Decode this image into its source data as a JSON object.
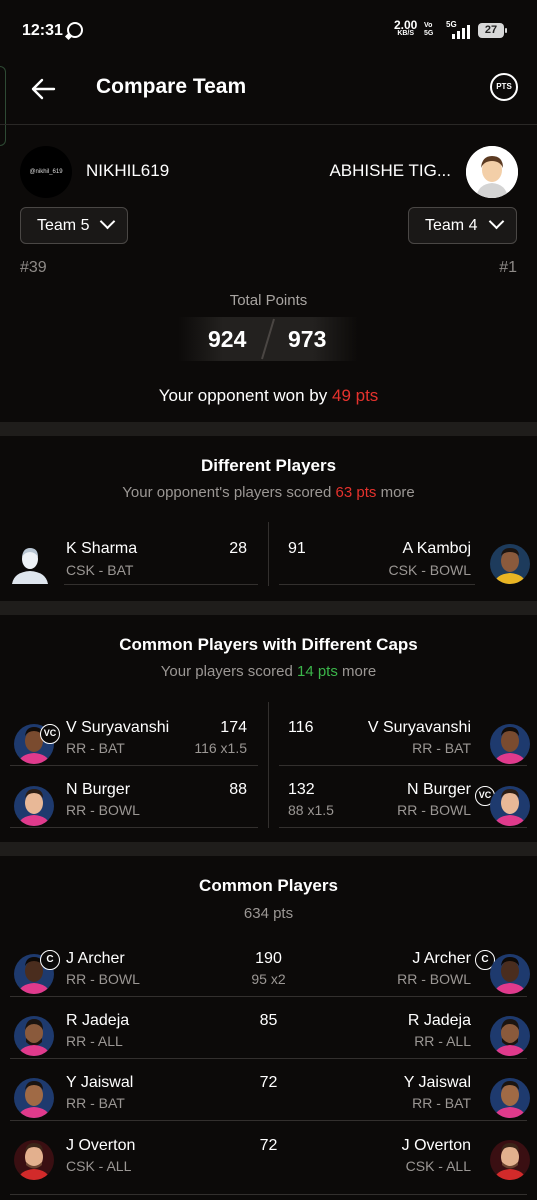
{
  "status_bar": {
    "time": "12:31",
    "whatsapp_icon": "whatsapp-icon",
    "net_speed": "2.00",
    "net_unit": "KB/S",
    "volte": "Vo",
    "volte2": "5G",
    "network": "5G",
    "battery": "27"
  },
  "header": {
    "title": "Compare Team",
    "back_icon": "arrow-left-icon",
    "pts_label": "PTS"
  },
  "left_team": {
    "avatar_text": "@nikhil_619",
    "username": "NIKHIL619",
    "team": "Team 5",
    "rank": "#39",
    "points": "924"
  },
  "right_team": {
    "username": "ABHISHE TIG...",
    "team": "Team 4",
    "rank": "#1",
    "points": "973"
  },
  "total_points_label": "Total Points",
  "result": {
    "prefix": "Your opponent won by ",
    "value": "49 pts"
  },
  "different_players": {
    "title": "Different Players",
    "sub_prefix": "Your opponent's players scored ",
    "sub_value": "63 pts",
    "sub_suffix": " more",
    "left": [
      {
        "name": "K Sharma",
        "role": "CSK - BAT",
        "pts": "28"
      }
    ],
    "right": [
      {
        "name": "A Kamboj",
        "role": "CSK - BOWL",
        "pts": "91"
      }
    ]
  },
  "common_diff_caps": {
    "title": "Common Players with Different Caps",
    "sub_prefix": "Your players scored ",
    "sub_value": "14 pts",
    "sub_suffix": " more",
    "left": [
      {
        "name": "V Suryavanshi",
        "role": "RR - BAT",
        "pts": "174",
        "mult": "116 x1.5",
        "cap": "VC"
      },
      {
        "name": "N Burger",
        "role": "RR - BOWL",
        "pts": "88",
        "mult": "",
        "cap": ""
      }
    ],
    "right": [
      {
        "name": "V Suryavanshi",
        "role": "RR - BAT",
        "pts": "116",
        "mult": "",
        "cap": ""
      },
      {
        "name": "N Burger",
        "role": "RR - BOWL",
        "pts": "132",
        "mult": "88 x1.5",
        "cap": "VC"
      }
    ]
  },
  "common_players": {
    "title": "Common Players",
    "sub": "634 pts",
    "rows": [
      {
        "name": "J Archer",
        "role": "RR - BOWL",
        "pts": "190",
        "mult": "95 x2",
        "cap": "C"
      },
      {
        "name": "R Jadeja",
        "role": "RR - ALL",
        "pts": "85",
        "mult": "",
        "cap": ""
      },
      {
        "name": "Y Jaiswal",
        "role": "RR - BAT",
        "pts": "72",
        "mult": "",
        "cap": ""
      },
      {
        "name": "J Overton",
        "role": "CSK - ALL",
        "pts": "72",
        "mult": "",
        "cap": ""
      }
    ]
  },
  "colors": {
    "background": "#0c0a09",
    "accent_red": "#e5322d",
    "accent_green": "#3bb54a"
  }
}
